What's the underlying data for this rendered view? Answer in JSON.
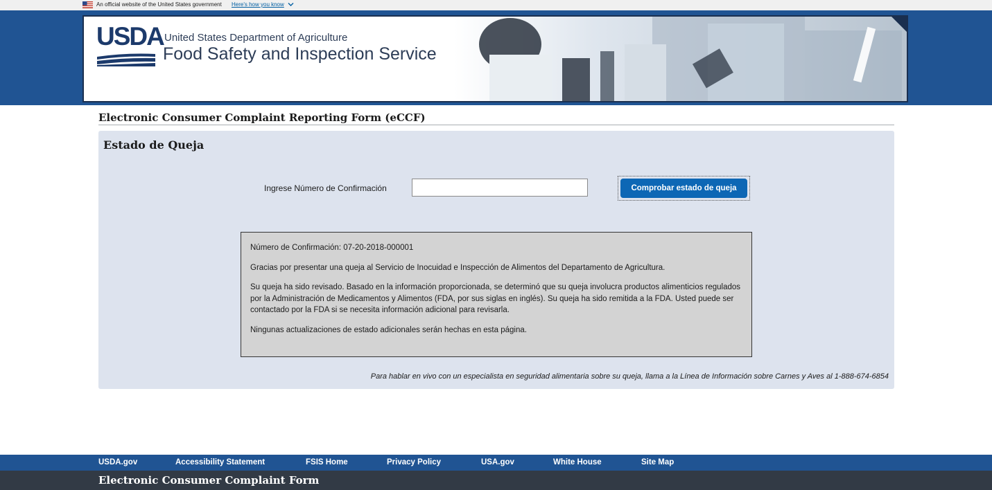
{
  "gov_banner": {
    "text": "An official website of the United States government",
    "link": "Here's how you know"
  },
  "header": {
    "logo": "USDA",
    "department": "United States Department of Agriculture",
    "agency": "Food Safety and Inspection Service"
  },
  "page_title": "Electronic Consumer Complaint Reporting Form (eCCF)",
  "panel": {
    "heading": "Estado de Queja",
    "confirm_label": "Ingrese Número de Confirmación",
    "confirm_value": "",
    "check_button": "Comprobar estado de queja",
    "status": {
      "confirmation": "Número de Confirmación: 07-20-2018-000001",
      "thanks": "Gracias por presentar una queja al Servicio de Inocuidad e Inspección de Alimentos del Departamento de Agricultura.",
      "reviewed": "Su queja ha sido revisado. Basado en la información proporcionada, se determinó que su queja involucra productos alimenticios regulados por la Administración de Medicamentos y Alimentos (FDA, por sus siglas en inglés). Su queja ha sido remitida a la FDA. Usted puede ser contactado por la FDA si se necesita información adicional para revisarla.",
      "no_updates": "Ningunas actualizaciones de estado adicionales serán hechas en esta página."
    },
    "hotline": "Para hablar en vivo con un especialista en seguridad alimentaria sobre su queja, llama a la Línea de Información sobre Carnes y Aves al 1-888-674-6854"
  },
  "footer": {
    "links": [
      "USDA.gov",
      "Accessibility Statement",
      "FSIS Home",
      "Privacy Policy",
      "USA.gov",
      "White House",
      "Site Map"
    ],
    "title": "Electronic Consumer Complaint Form"
  },
  "colors": {
    "header_blue": "#205493",
    "panel_bg": "#dde3ee",
    "button_blue": "#0d67b5",
    "footer_dark": "#323a45",
    "status_box_bg": "#d3d3d3"
  }
}
